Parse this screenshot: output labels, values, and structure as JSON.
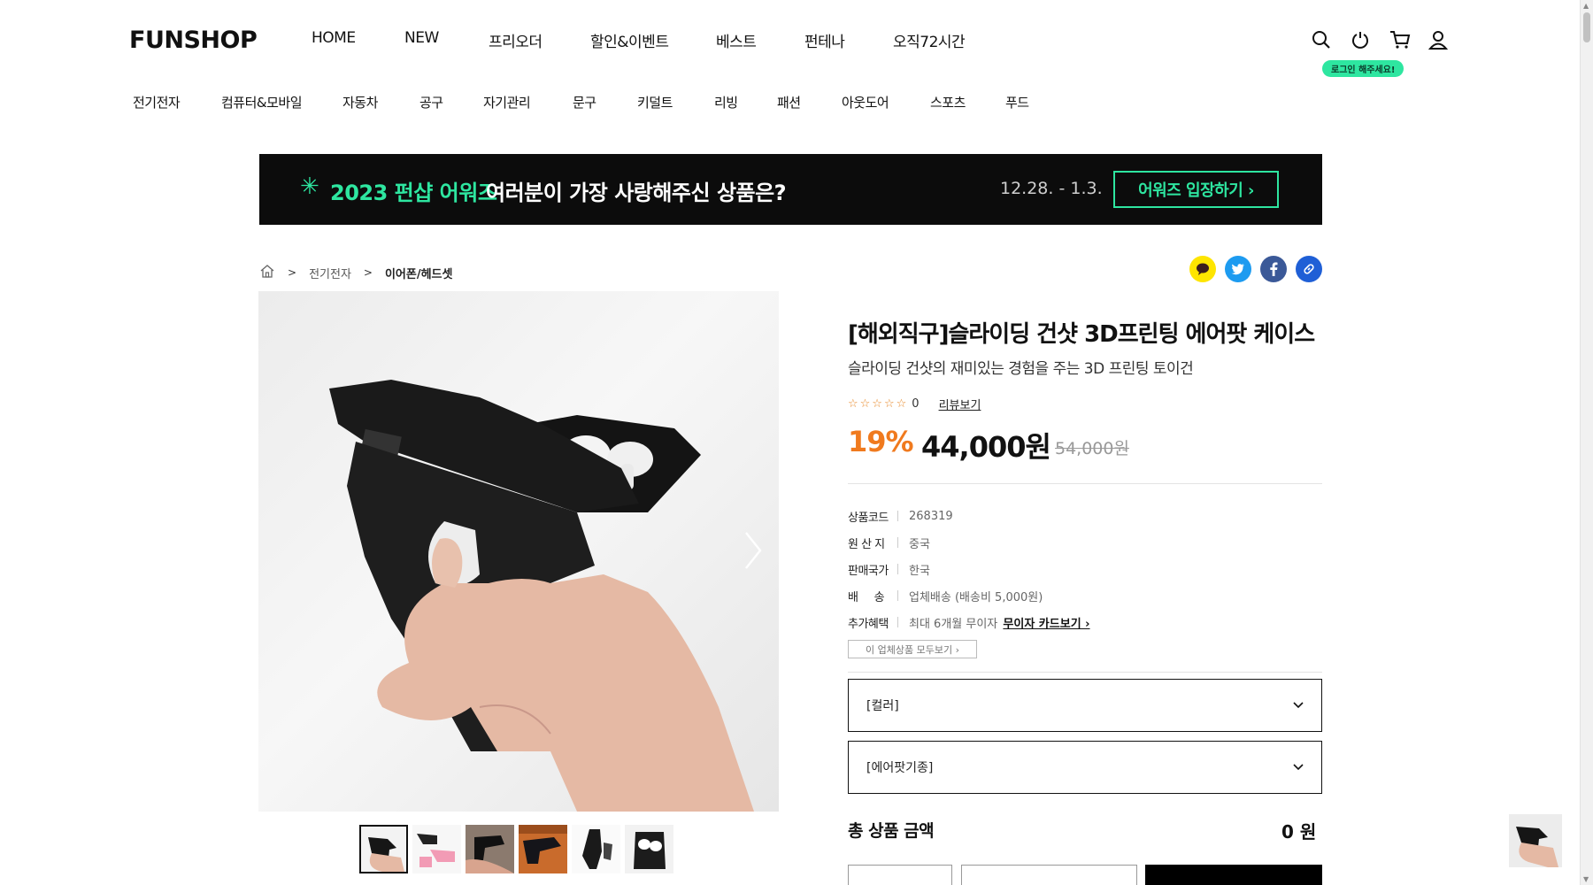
{
  "header": {
    "logo": "FUNSHOP",
    "nav": [
      "HOME",
      "NEW",
      "프리오더",
      "할인&이벤트",
      "베스트",
      "펀테나",
      "오직72시간"
    ],
    "icons": [
      "search-icon",
      "power-icon",
      "cart-icon",
      "user-icon"
    ],
    "login_pill": "로그인 해주세요!"
  },
  "categories": [
    "전기전자",
    "컴퓨터&모바일",
    "자동차",
    "공구",
    "자기관리",
    "문구",
    "키덜트",
    "리빙",
    "패션",
    "아웃도어",
    "스포츠",
    "푸드"
  ],
  "banner": {
    "star": "✳",
    "year": "2023 펀샵 어워즈",
    "text": "여러분이 가장 사랑해주신 상품은?",
    "date": "12.28. - 1.3.",
    "button": "어워즈 입장하기 ›"
  },
  "breadcrumb": {
    "home_icon": "home-icon",
    "items": [
      "전기전자",
      "이어폰/헤드셋"
    ]
  },
  "share": {
    "icons": [
      "kakao-icon",
      "twitter-icon",
      "facebook-icon",
      "link-icon"
    ],
    "colors": [
      "#fee500",
      "#1d9bf0",
      "#3b5998",
      "#1f5fd6"
    ]
  },
  "product": {
    "title": "[해외직구]슬라이딩 건샷 3D프린팅 에어팟 케이스",
    "subtitle": "슬라이딩 건샷의 재미있는 경험을 주는 3D 프린팅 토이건",
    "stars": "☆☆☆☆☆",
    "review_count": "0",
    "review_link": "리뷰보기",
    "discount": "19%",
    "price": "44,000원",
    "original_price": "54,000원",
    "info": [
      {
        "key": "상품코드",
        "value": "268319"
      },
      {
        "key": "원 산 지",
        "value": "중국"
      },
      {
        "key": "판매국가",
        "value": "한국"
      },
      {
        "key": "배     송",
        "value": "업체배송 (배송비 5,000원)"
      },
      {
        "key": "추가혜택",
        "value": "최대 6개월 무이자",
        "link": "무이자 카드보기 ›"
      }
    ],
    "vendor_button": "이 업체상품 모두보기 ›",
    "options": [
      "[컬러]",
      "[에어팟기종]"
    ],
    "total_label": "총 상품 금액",
    "total_value": "0 원"
  },
  "thumbnails": 6,
  "accent_color": "#2ee6a0",
  "discount_color": "#f07a1e"
}
